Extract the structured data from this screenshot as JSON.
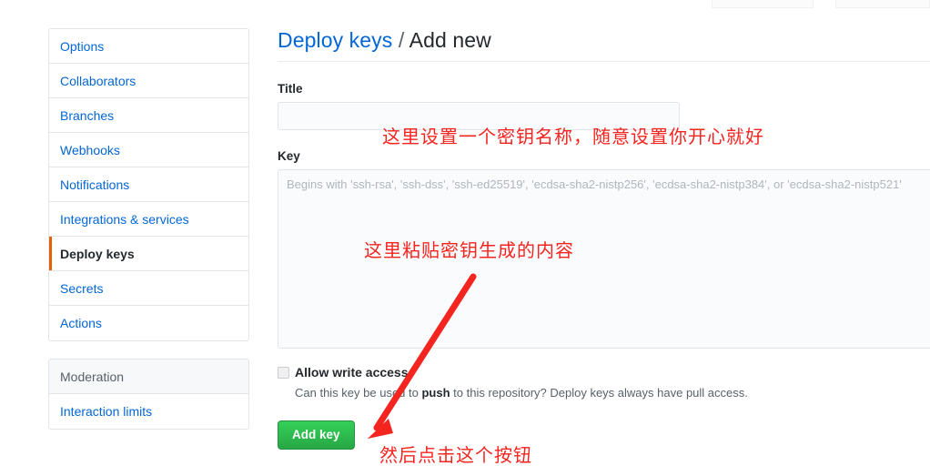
{
  "sidebar": {
    "settings_items": [
      {
        "label": "Options",
        "selected": false
      },
      {
        "label": "Collaborators",
        "selected": false
      },
      {
        "label": "Branches",
        "selected": false
      },
      {
        "label": "Webhooks",
        "selected": false
      },
      {
        "label": "Notifications",
        "selected": false
      },
      {
        "label": "Integrations & services",
        "selected": false
      },
      {
        "label": "Deploy keys",
        "selected": true
      },
      {
        "label": "Secrets",
        "selected": false
      },
      {
        "label": "Actions",
        "selected": false
      }
    ],
    "moderation_header": "Moderation",
    "moderation_items": [
      {
        "label": "Interaction limits"
      }
    ]
  },
  "main": {
    "breadcrumb_link": "Deploy keys",
    "breadcrumb_sep": "/",
    "breadcrumb_current": "Add new",
    "title_label": "Title",
    "title_value": "",
    "title_placeholder": "",
    "key_label": "Key",
    "key_value": "",
    "key_placeholder": "Begins with 'ssh-rsa', 'ssh-dss', 'ssh-ed25519', 'ecdsa-sha2-nistp256', 'ecdsa-sha2-nistp384', or 'ecdsa-sha2-nistp521'",
    "allow_write_label": "Allow write access",
    "allow_write_checked": false,
    "help_text_before": "Can this key be used to ",
    "help_text_bold": "push",
    "help_text_after": " to this repository? Deploy keys always have pull access.",
    "submit_label": "Add key"
  },
  "annotations": [
    {
      "text": "这里设置一个密钥名称，随意设置你开心就好"
    },
    {
      "text": "这里粘贴密钥生成的内容"
    },
    {
      "text": "然后点击这个按钮"
    }
  ],
  "colors": {
    "link_blue": "#0366d6",
    "active_orange": "#e36209",
    "button_green": "#28a745",
    "annotation_red": "#f4241f",
    "border_gray": "#e1e4e8"
  }
}
